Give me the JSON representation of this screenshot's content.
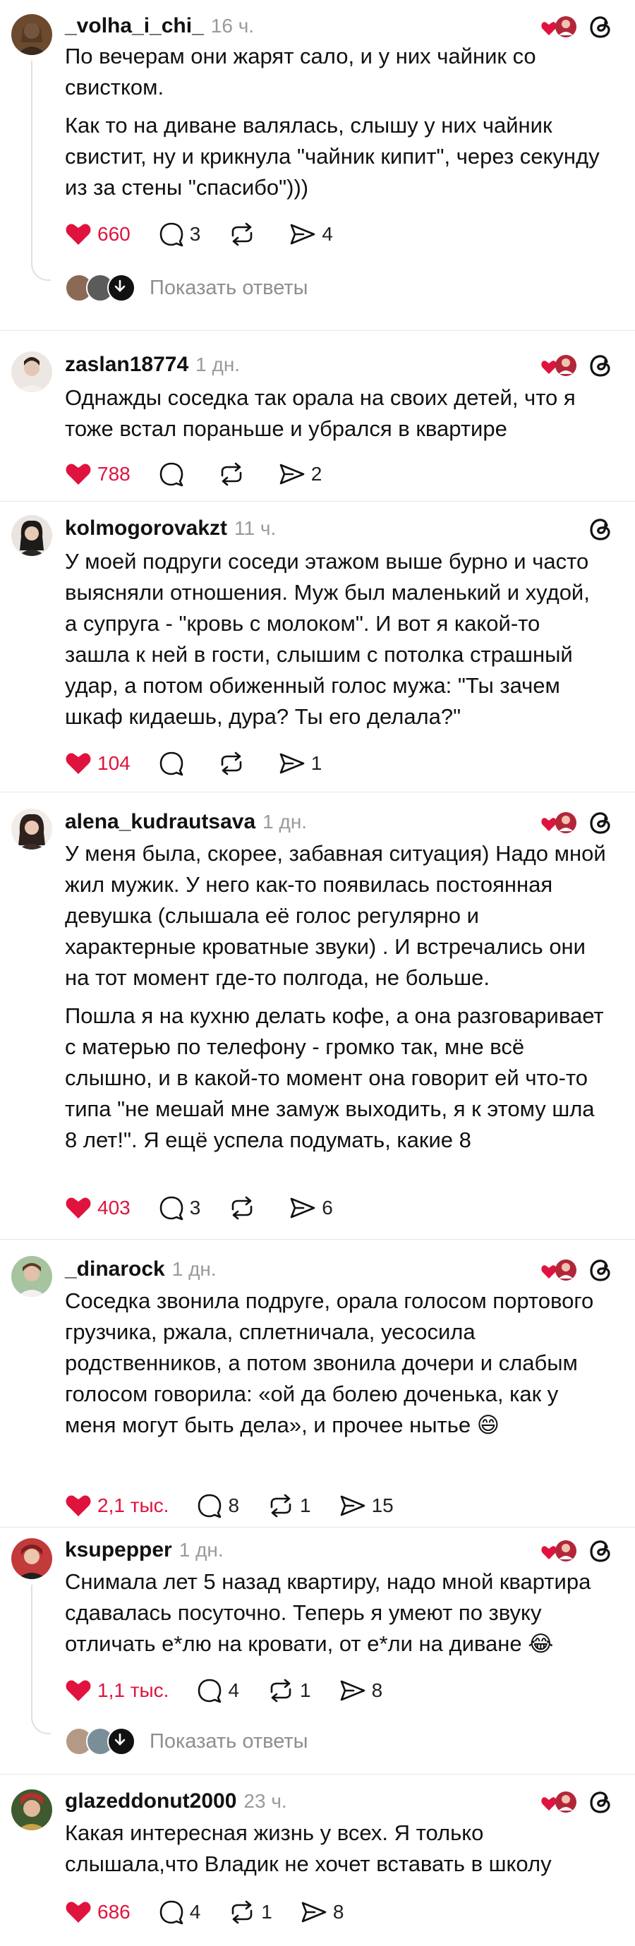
{
  "posts": [
    {
      "username": "_volha_i_chi_",
      "time": "16 ч.",
      "paragraphs": [
        "По вечерам они жарят сало, и у них чайник со свистком.",
        "Как то на диване валялась, слышу у них чайник свистит, ну и крикнула \"чайник кипит\", через секунду из за стены \"спасибо\")))"
      ],
      "likes": "660",
      "comments": "3",
      "reposts": "",
      "shares": "4",
      "show_replies": "Показать ответы"
    },
    {
      "username": "zaslan18774",
      "time": "1 дн.",
      "paragraphs": [
        "Однажды соседка так орала на своих детей, что я тоже встал пораньше и убрался в квартире"
      ],
      "likes": "788",
      "comments": "",
      "reposts": "",
      "shares": "2"
    },
    {
      "username": "kolmogorovakzt",
      "time": "11 ч.",
      "paragraphs": [
        "У моей подруги соседи этажом выше бурно и часто выясняли отношения. Муж был маленький и худой, а супруга - \"кровь с молоком\". И вот я какой-то зашла к ней в гости, слышим с потолка страшный удар, а потом обиженный голос мужа: \"Ты зачем шкаф кидаешь, дура? Ты его делала?\""
      ],
      "likes": "104",
      "comments": "",
      "reposts": "",
      "shares": "1"
    },
    {
      "username": "alena_kudrautsava",
      "time": "1 дн.",
      "paragraphs": [
        "У меня была, скорее, забавная ситуация) Надо мной жил мужик. У него как-то появилась постоянная девушка (слышала её голос регулярно и характерные кроватные звуки) . И встречались они на тот момент где-то полгода, не больше.",
        "Пошла я на кухню делать кофе, а она разговаривает с матерью по телефону - громко так, мне всё слышно, и в какой-то момент она говорит ей что-то типа \"не мешай мне замуж выходить, я к этому шла 8 лет!\". Я ещё успела подумать, какие 8"
      ],
      "likes": "403",
      "comments": "3",
      "reposts": "",
      "shares": "6"
    },
    {
      "username": "_dinarock",
      "time": "1 дн.",
      "paragraphs": [
        "Соседка звонила подруге, орала голосом портового грузчика, ржала, сплетничала, уесосила родственников, а потом звонила дочери и слабым голосом говорила: «ой да болею доченька, как у меня могут быть дела», и прочее нытье 😄"
      ],
      "likes": "2,1 тыс.",
      "comments": "8",
      "reposts": "1",
      "shares": "15"
    },
    {
      "username": "ksupepper",
      "time": "1 дн.",
      "paragraphs": [
        "Снимала лет 5 назад квартиру, надо мной квартира сдавалась посуточно. Теперь я умеют по звуку отличать е*лю на кровати, от е*ли на диване 😂"
      ],
      "likes": "1,1 тыс.",
      "comments": "4",
      "reposts": "1",
      "shares": "8",
      "show_replies": "Показать ответы"
    },
    {
      "username": "glazeddonut2000",
      "time": "23 ч.",
      "paragraphs": [
        "Какая интересная жизнь у всех.  Я только слышала,что Владик не хочет вставать в школу"
      ],
      "likes": "686",
      "comments": "4",
      "reposts": "1",
      "shares": "8"
    }
  ],
  "colors": {
    "like": "#e0133e",
    "muted": "#8e8e8e",
    "text": "#111111",
    "divider": "#e6e6e6"
  },
  "icons": [
    "heart-icon",
    "comment-icon",
    "repost-icon",
    "share-icon",
    "threads-logo-icon",
    "liked-by-author-badge-icon"
  ]
}
